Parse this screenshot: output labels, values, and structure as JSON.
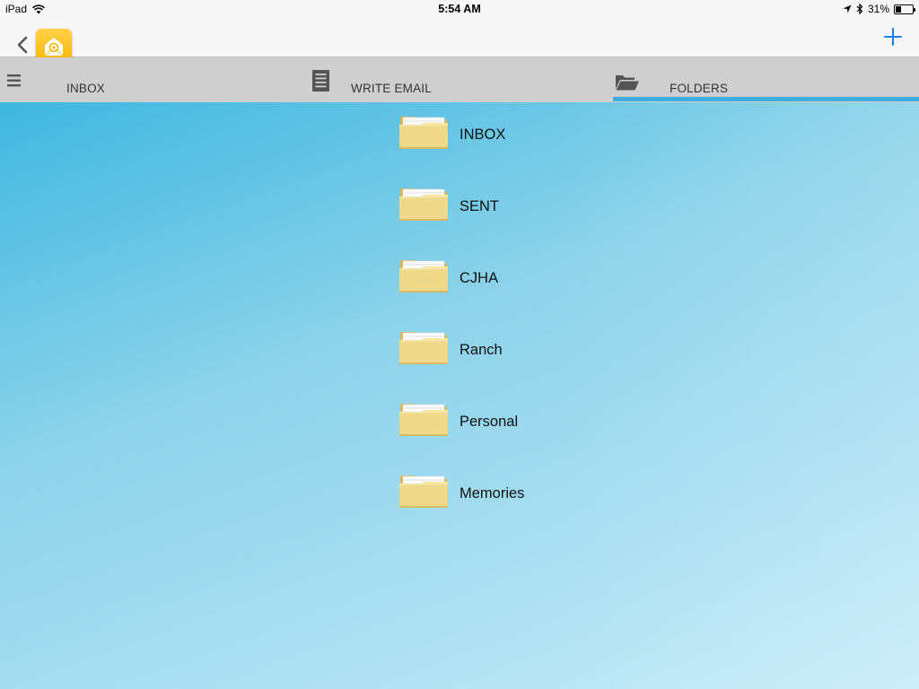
{
  "status_bar": {
    "device": "iPad",
    "time": "5:54 AM",
    "battery": "31%"
  },
  "nav": {
    "back_icon": "chevron-left-icon",
    "logo_icon": "mail-app-logo",
    "add_icon": "plus-icon"
  },
  "tabs": [
    {
      "label": "INBOX",
      "icon": "hamburger-menu-icon"
    },
    {
      "label": "WRITE EMAIL",
      "icon": "document-icon"
    },
    {
      "label": "FOLDERS",
      "icon": "open-folder-icon",
      "selected": true
    }
  ],
  "folders": [
    {
      "label": "INBOX"
    },
    {
      "label": "SENT"
    },
    {
      "label": "CJHA"
    },
    {
      "label": "Ranch"
    },
    {
      "label": "Personal"
    },
    {
      "label": "Memories"
    }
  ],
  "colors": {
    "accent": "#1a7fe8",
    "tab_indicator": "#3aaee0",
    "tab_bar": "#cfcfcf",
    "background_top": "#3fb7e0",
    "background_bottom": "#c7ecf7",
    "folder_yellow": "#f0d98a"
  }
}
